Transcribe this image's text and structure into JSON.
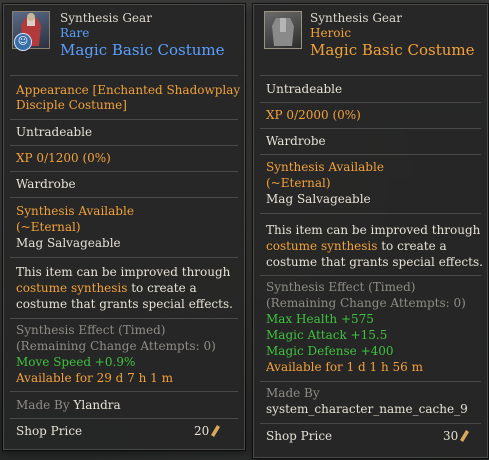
{
  "left": {
    "type": "Synthesis Gear",
    "grade": "Rare",
    "name": "Magic Basic Costume",
    "icon": "costume-robe-blue-icon",
    "badge_icon": "character-badge-icon",
    "appearance_line1": "Appearance [Enchanted Shadowplay",
    "appearance_line2": "Disciple Costume]",
    "tradeable": "Untradeable",
    "xp": "XP 0/1200 (0%)",
    "wardrobe": "Wardrobe",
    "synthesis_available": "Synthesis Available",
    "eternal": "(~Eternal)",
    "salvage": "Mag Salvageable",
    "improve_line1": "This item can be improved through",
    "improve_highlight": "costume synthesis",
    "improve_line2_rest": " to create a",
    "improve_line3": "costume that grants special effects.",
    "effect_title": "Synthesis Effect (Timed)",
    "effect_attempts": "(Remaining Change Attempts: 0)",
    "effects": [
      "Move Speed +0.9%"
    ],
    "available_for": "Available for 29 d  7 h  1 m",
    "made_by_label": "Made By",
    "made_by_value": "Ylandra",
    "shop_price_label": "Shop Price",
    "shop_price_value": "20"
  },
  "right": {
    "type": "Synthesis Gear",
    "grade": "Heroic",
    "name": "Magic Basic Costume",
    "icon": "costume-robe-gray-icon",
    "tradeable": "Untradeable",
    "xp": "XP 0/2000 (0%)",
    "wardrobe": "Wardrobe",
    "synthesis_available": "Synthesis Available",
    "eternal": "(~Eternal)",
    "salvage": "Mag Salvageable",
    "improve_line1": "This item can be improved through",
    "improve_highlight": "costume synthesis",
    "improve_line2_rest": " to create a",
    "improve_line3": "costume that grants special effects.",
    "effect_title": "Synthesis Effect (Timed)",
    "effect_attempts": "(Remaining Change Attempts: 0)",
    "effects": [
      "Max Health +575",
      "Magic Attack +15.5",
      "Magic Defense +400"
    ],
    "available_for": "Available for 1 d  1 h  56 m",
    "made_by_label": "Made By",
    "made_by_value": "system_character_name_cache_9",
    "shop_price_label": "Shop Price",
    "shop_price_value": "30"
  },
  "colors": {
    "rare": "#5aa0ff",
    "heroic": "#f2a23a",
    "accent_orange": "#f2a23a",
    "effect_green": "#3fc23f",
    "muted_gray": "#8f8c86"
  }
}
